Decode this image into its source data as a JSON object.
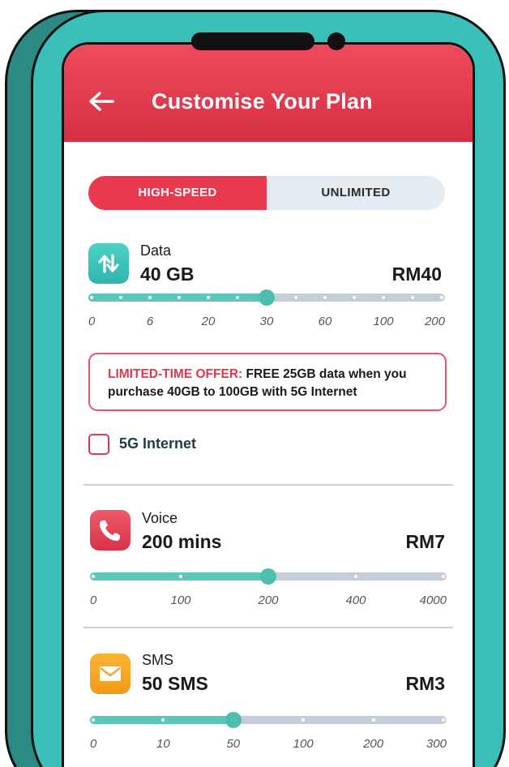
{
  "header": {
    "back_icon": "arrow-left-icon",
    "title": "Customise Your Plan",
    "color": "#e23a4e"
  },
  "toggle": {
    "options": [
      "HIGH-SPEED",
      "UNLIMITED"
    ],
    "selected": "HIGH-SPEED"
  },
  "data": {
    "icon": "data-transfer-icon",
    "name": "Data",
    "amount": "40 GB",
    "price": "RM40",
    "slider": {
      "ticks": [
        "0",
        "6",
        "20",
        "30",
        "60",
        "100",
        "200"
      ],
      "value_label": "40",
      "position_fraction": 0.5
    },
    "offer": {
      "label": "LIMITED-TIME OFFER:",
      "line1": " FREE 25GB data when you",
      "line2": "purchase 40GB to 100GB with 5G Internet"
    },
    "checkbox": {
      "label": "5G Internet",
      "checked": false
    }
  },
  "voice": {
    "icon": "phone-icon",
    "name": "Voice",
    "amount": "200 mins",
    "price": "RM7",
    "slider": {
      "ticks": [
        "0",
        "100",
        "200",
        "400",
        "4000"
      ],
      "value_label": "200",
      "position_fraction": 0.5
    }
  },
  "sms": {
    "icon": "envelope-icon",
    "name": "SMS",
    "amount": "50 SMS",
    "price": "RM3",
    "slider": {
      "ticks": [
        "0",
        "10",
        "50",
        "100",
        "200",
        "300"
      ],
      "value_label": "50",
      "position_fraction": 0.4
    }
  },
  "colors": {
    "accent_red": "#e8394f",
    "teal": "#3bbfb9",
    "slider_fill": "#5cc6b8"
  }
}
